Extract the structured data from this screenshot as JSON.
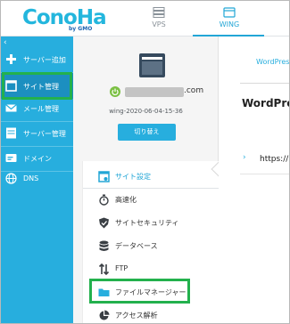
{
  "brand": {
    "logo_text": "ConoHa",
    "logo_sub": "by GMO"
  },
  "top_nav": {
    "tabs": [
      {
        "label": "VPS",
        "icon": "server-stack-icon",
        "active": false
      },
      {
        "label": "WING",
        "icon": "wing-icon",
        "active": true
      }
    ]
  },
  "sidebar": {
    "collapse_glyph": "‹",
    "items": [
      {
        "label": "サーバー追加",
        "icon": "plus-icon"
      },
      {
        "label": "サイト管理",
        "icon": "window-icon",
        "active": true
      },
      {
        "label": "メール管理",
        "icon": "mail-icon"
      },
      {
        "label": "サーバー管理",
        "icon": "server-icon"
      },
      {
        "label": "ドメイン",
        "icon": "domain-icon"
      },
      {
        "label": "DNS",
        "icon": "globe-icon"
      }
    ]
  },
  "server": {
    "name": ".com",
    "id": "wing-2020-06-04-15-36",
    "switch_label": "切り替え",
    "status_color": "#7bc043"
  },
  "site_menu": {
    "items": [
      {
        "label": "サイト設定",
        "icon": "site-settings-icon"
      },
      {
        "label": "高速化",
        "icon": "stopwatch-icon"
      },
      {
        "label": "サイトセキュリティ",
        "icon": "shield-icon"
      },
      {
        "label": "データベース",
        "icon": "database-icon"
      },
      {
        "label": "FTP",
        "icon": "transfer-arrows-icon"
      },
      {
        "label": "ファイルマネージャー",
        "icon": "folder-icon"
      },
      {
        "label": "アクセス解析",
        "icon": "pie-chart-icon"
      }
    ]
  },
  "right_panel": {
    "tab_label": "WordPress",
    "title": "WordPress",
    "url_arrow": "›",
    "url_text": "https://"
  },
  "colors": {
    "accent": "#27aede",
    "sidebar_bg": "#27aede",
    "highlight": "#23b14d"
  }
}
